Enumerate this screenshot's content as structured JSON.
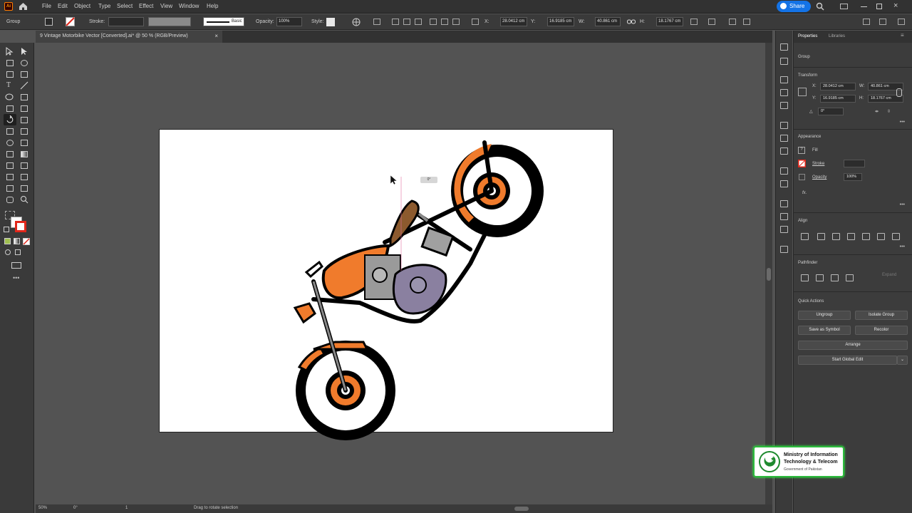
{
  "app": {
    "logo": "Ai"
  },
  "menu": [
    "File",
    "Edit",
    "Object",
    "Type",
    "Select",
    "Effect",
    "View",
    "Window",
    "Help"
  ],
  "share": {
    "label": "Share"
  },
  "control": {
    "selection_label": "Group",
    "stroke_label": "Stroke:",
    "brush_label": "Basic",
    "opacity_label": "Opacity:",
    "opacity_value": "100%",
    "style_label": "Style:",
    "x_label": "X:",
    "x_value": "28.0412 cm",
    "y_label": "Y:",
    "y_value": "16.9185 cm",
    "w_label": "W:",
    "w_value": "40.861 cm",
    "h_label": "H:",
    "h_value": "18.1767 cm"
  },
  "document": {
    "tab_title": "9 Vintage Motorbike Vector [Converted].ai* @ 50 % (RGB/Preview)",
    "close": "×"
  },
  "canvas": {
    "tooltip": "0°"
  },
  "status": {
    "zoom": "50%",
    "rotation": "0°",
    "artboard": "1",
    "tool_hint": "Drag to rotate selection"
  },
  "panel": {
    "tabs": [
      "Properties",
      "Libraries"
    ],
    "group_label": "Group",
    "transform": {
      "title": "Transform",
      "x_label": "X:",
      "x": "28.0412 cm",
      "y_label": "Y:",
      "y": "16.9185 cm",
      "w_label": "W:",
      "w": "40.861 cm",
      "h_label": "H:",
      "h": "18.1767 cm",
      "angle": "0°"
    },
    "appearance": {
      "title": "Appearance",
      "fill": "Fill",
      "stroke": "Stroke",
      "opacity": "Opacity",
      "opacity_value": "100%",
      "fx": "fx."
    },
    "align": {
      "title": "Align"
    },
    "pathfinder": {
      "title": "Pathfinder",
      "expand": "Expand"
    },
    "quick_actions": {
      "title": "Quick Actions",
      "ungroup": "Ungroup",
      "isolate": "Isolate Group",
      "save_symbol": "Save as Symbol",
      "recolor": "Recolor",
      "arrange": "Arrange",
      "global_edit": "Start Global Edit"
    }
  },
  "ministry": {
    "line1": "Ministry of Information",
    "line2": "Technology & Telecom",
    "line3": "Government of Pakistan"
  },
  "colors": {
    "accent_orange": "#f08030",
    "share_blue": "#1473e6",
    "badge_green": "#2cba3c"
  }
}
